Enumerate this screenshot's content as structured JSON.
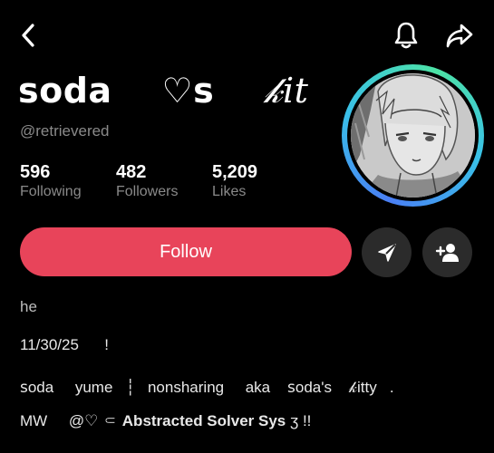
{
  "topbar": {
    "back_icon": "chevron-left-icon",
    "bell_icon": "bell-icon",
    "share_icon": "share-arrow-icon"
  },
  "profile": {
    "display_name_part1": "ꜱoda",
    "display_name_part2": "    ♡s    ",
    "display_name_part3": "𝓀it",
    "handle": "@retrievered",
    "stats": {
      "following": {
        "value": "596",
        "label": "Following"
      },
      "followers": {
        "value": "482",
        "label": "Followers"
      },
      "likes": {
        "value": "5,209",
        "label": "Likes"
      }
    },
    "avatar_ring_colors": [
      "#4a7ff5",
      "#39c0e8",
      "#4de3a6"
    ]
  },
  "actions": {
    "follow_label": "Follow",
    "follow_color": "#e8445a",
    "message_icon": "send-message-icon",
    "add_user_icon": "add-user-icon"
  },
  "bio": {
    "line1": "he",
    "line2": "11/30/25      !",
    "line3_a": "ꜱoda     yume   ┆   nonsharing     aka    ꜱoda's    𝓀itty   .",
    "line4_a": "MW     @♡ ⸦ ",
    "line4_b": "Abstracted Solver Sys",
    "line4_c": " ʒ !!"
  }
}
